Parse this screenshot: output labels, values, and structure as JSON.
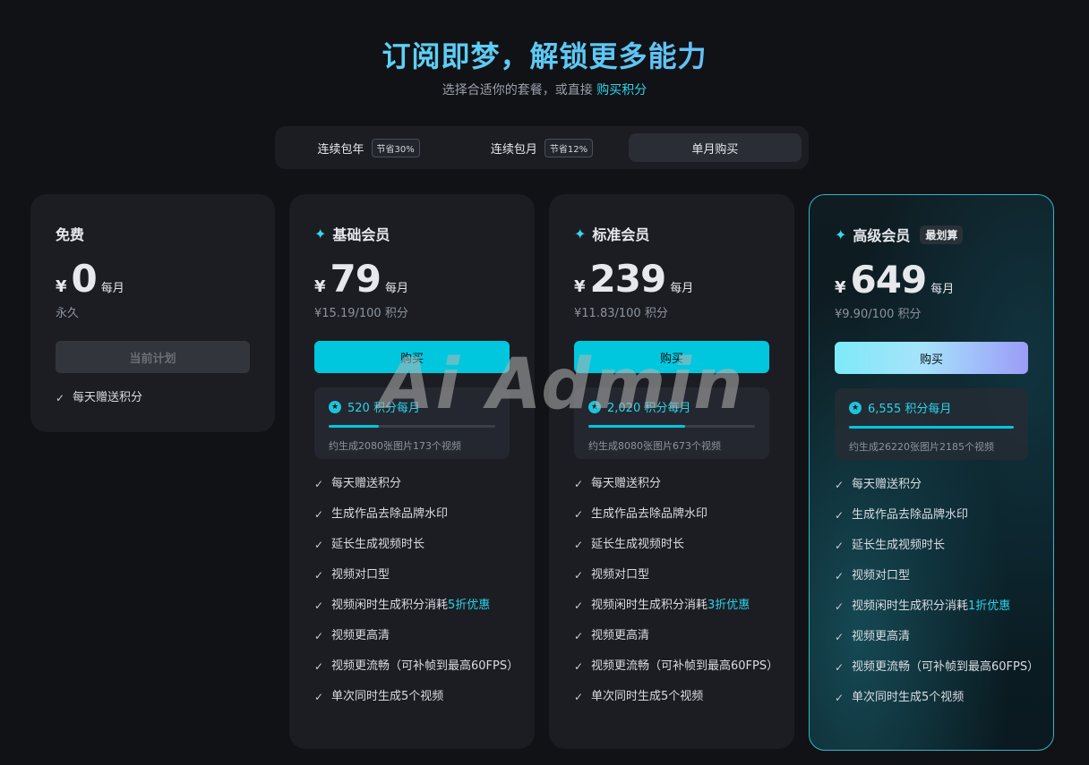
{
  "header": {
    "title": "订阅即梦，解锁更多能力",
    "subtitle_prefix": "选择合适你的套餐，或直接",
    "subtitle_link": "购买积分"
  },
  "tabs": [
    {
      "label": "连续包年",
      "badge": "节省30%"
    },
    {
      "label": "连续包月",
      "badge": "节省12%"
    },
    {
      "label": "单月购买",
      "badge": ""
    }
  ],
  "plans": {
    "free": {
      "name": "免费",
      "currency": "¥",
      "amount": "0",
      "period": "每月",
      "sub_price": "永久",
      "button": "当前计划",
      "features": [
        "每天赠送积分"
      ]
    },
    "basic": {
      "name": "基础会员",
      "currency": "¥",
      "amount": "79",
      "period": "每月",
      "sub_price": "¥15.19/100 积分",
      "button": "购买",
      "credits": "520 积分每月",
      "credits_fraction": 0.3,
      "credits_desc": "约生成2080张图片173个视频",
      "features": {
        "f1": "每天赠送积分",
        "f2": "生成作品去除品牌水印",
        "f3": "延长生成视频时长",
        "f4": "视频对口型",
        "f5_prefix": "视频闲时生成积分消耗",
        "f5_hl": "5折优惠",
        "f6": "视频更高清",
        "f7": "视频更流畅（可补帧到最高60FPS）",
        "f8": "单次同时生成5个视频"
      }
    },
    "std": {
      "name": "标准会员",
      "currency": "¥",
      "amount": "239",
      "period": "每月",
      "sub_price": "¥11.83/100 积分",
      "button": "购买",
      "credits": "2,020 积分每月",
      "credits_fraction": 0.58,
      "credits_desc": "约生成8080张图片673个视频",
      "features": {
        "f1": "每天赠送积分",
        "f2": "生成作品去除品牌水印",
        "f3": "延长生成视频时长",
        "f4": "视频对口型",
        "f5_prefix": "视频闲时生成积分消耗",
        "f5_hl": "3折优惠",
        "f6": "视频更高清",
        "f7": "视频更流畅（可补帧到最高60FPS）",
        "f8": "单次同时生成5个视频"
      }
    },
    "pro": {
      "name": "高级会员",
      "tag": "最划算",
      "currency": "¥",
      "amount": "649",
      "period": "每月",
      "sub_price": "¥9.90/100 积分",
      "button": "购买",
      "credits": "6,555 积分每月",
      "credits_fraction": 1.0,
      "credits_desc": "约生成26220张图片2185个视频",
      "features": {
        "f1": "每天赠送积分",
        "f2": "生成作品去除品牌水印",
        "f3": "延长生成视频时长",
        "f4": "视频对口型",
        "f5_prefix": "视频闲时生成积分消耗",
        "f5_hl": "1折优惠",
        "f6": "视频更高清",
        "f7": "视频更流畅（可补帧到最高60FPS）",
        "f8": "单次同时生成5个视频"
      }
    }
  },
  "watermark": "Ai Admin",
  "colors": {
    "accent": "#00c7dd",
    "highlight_text": "#2ad4ea",
    "background": "#111216",
    "card": "#1b1d23"
  }
}
